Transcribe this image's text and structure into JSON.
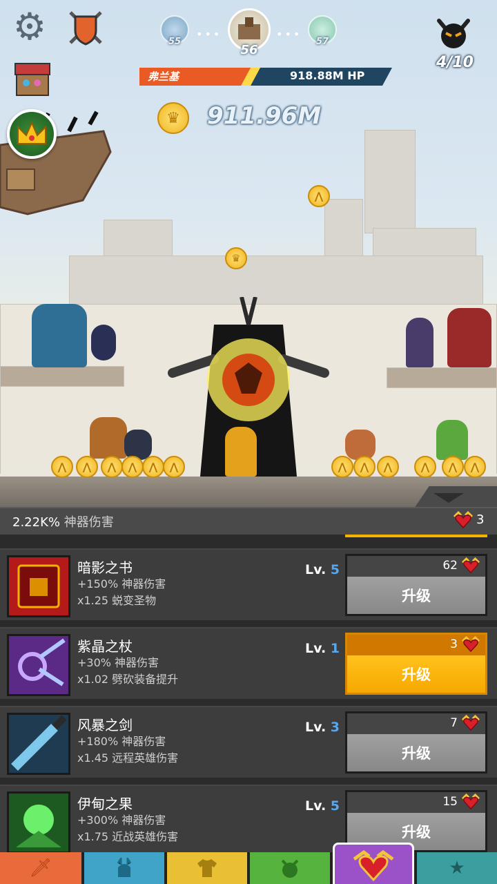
{
  "stage": {
    "prev": "55",
    "current": "56",
    "next": "57"
  },
  "boss": {
    "count": "4/10"
  },
  "enemy": {
    "name": "弗兰基",
    "hp": "918.88M HP",
    "hp_fill": 0.44
  },
  "gold": {
    "amount": "911.96M"
  },
  "panel": {
    "total_artifact_damage": "2.22K%",
    "total_artifact_damage_label": "神器伤害",
    "relics": "3"
  },
  "artifacts": [
    {
      "name": "暗影之书",
      "bonus": "+150% 神器伤害",
      "effect": "x1.25 蜕变圣物",
      "lv_label": "Lv.",
      "lv": "5",
      "cost": "62",
      "button": "升级",
      "affordable": false,
      "icon_color": "#b51a1a"
    },
    {
      "name": "紫晶之杖",
      "bonus": "+30% 神器伤害",
      "effect": "x1.02 劈砍装备提升",
      "lv_label": "Lv.",
      "lv": "1",
      "cost": "3",
      "button": "升级",
      "affordable": true,
      "icon_color": "#5a2a86"
    },
    {
      "name": "风暴之剑",
      "bonus": "+180% 神器伤害",
      "effect": "x1.45 远程英雄伤害",
      "lv_label": "Lv.",
      "lv": "3",
      "cost": "7",
      "button": "升级",
      "affordable": false,
      "icon_color": "#1f3b52"
    },
    {
      "name": "伊甸之果",
      "bonus": "+300% 神器伤害",
      "effect": "x1.75 近战英雄伤害",
      "lv_label": "Lv.",
      "lv": "5",
      "cost": "15",
      "button": "升级",
      "affordable": false,
      "icon_color": "#1c5a22"
    }
  ],
  "tabs": [
    {
      "id": "sword",
      "icon": "sword-icon"
    },
    {
      "id": "heroes",
      "icon": "helmet-icon"
    },
    {
      "id": "equipment",
      "icon": "shirt-icon"
    },
    {
      "id": "pets",
      "icon": "pet-icon"
    },
    {
      "id": "artifacts",
      "icon": "winged-heart-icon",
      "active": true
    },
    {
      "id": "shop",
      "icon": "star-icon"
    }
  ]
}
